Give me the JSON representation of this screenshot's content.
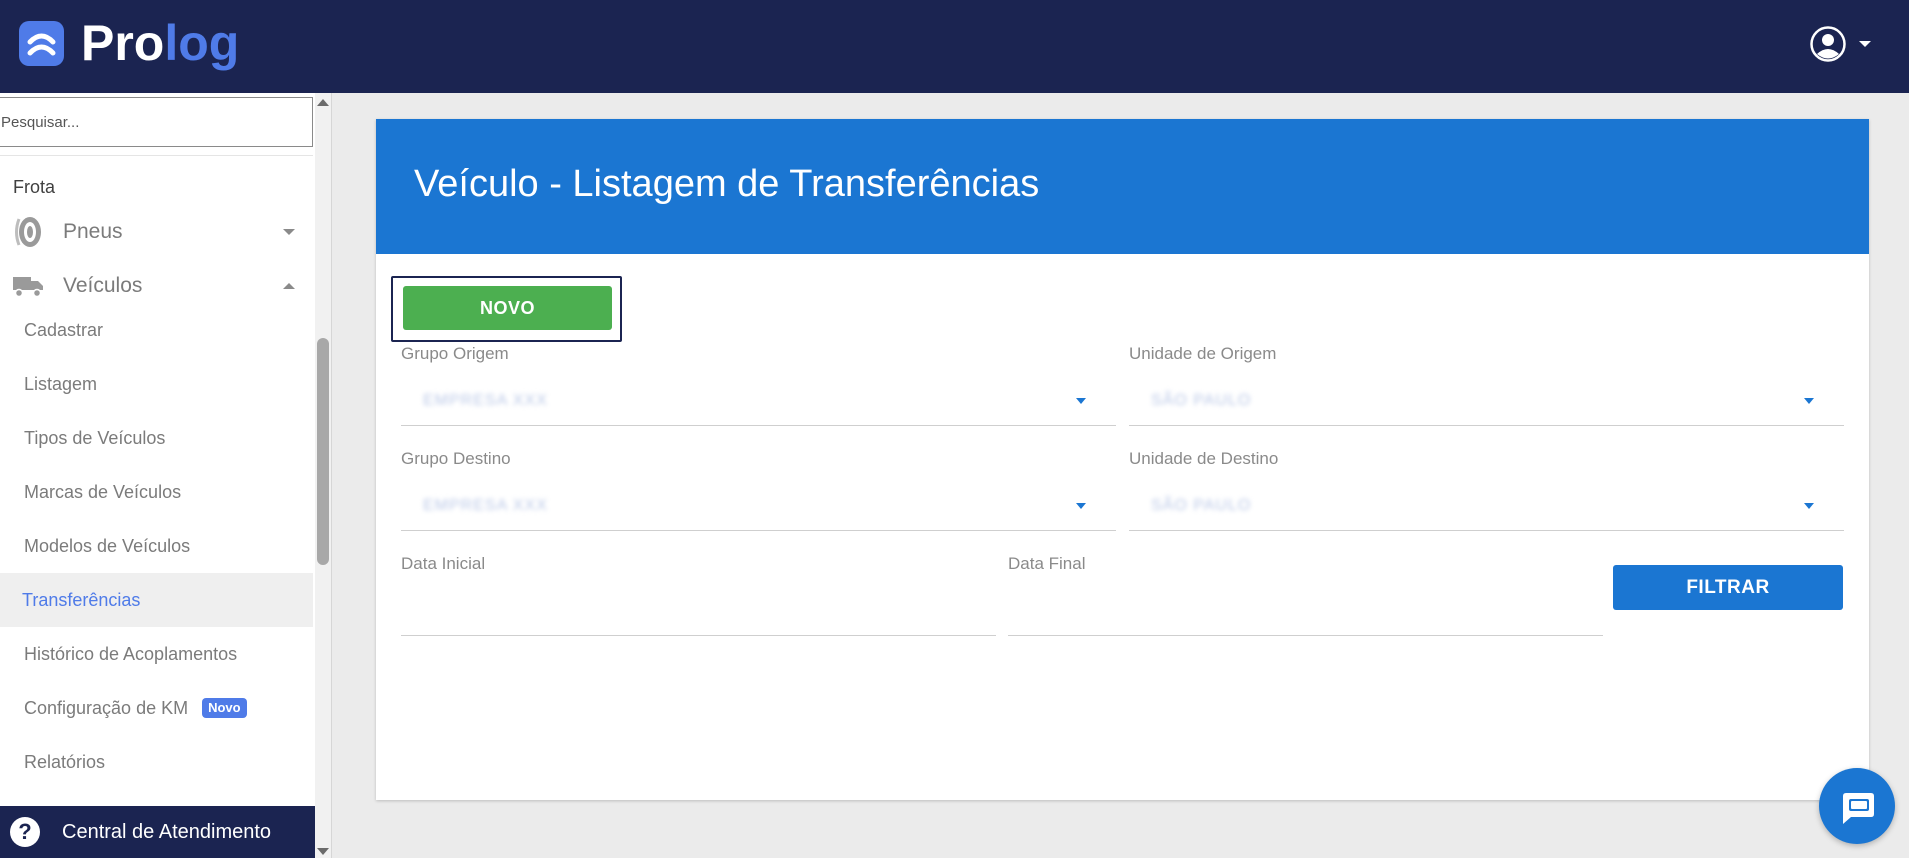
{
  "header": {
    "logo_part1": "Pro",
    "logo_part2": "log",
    "user_icon": "user-circle-icon"
  },
  "sidebar": {
    "search_placeholder": "Pesquisar...",
    "section": "Frota",
    "groups": [
      {
        "label": "Pneus",
        "icon": "tire-icon",
        "expanded": false
      },
      {
        "label": "Veículos",
        "icon": "truck-icon",
        "expanded": true
      }
    ],
    "items": [
      {
        "label": "Cadastrar"
      },
      {
        "label": "Listagem"
      },
      {
        "label": "Tipos de Veículos"
      },
      {
        "label": "Marcas de Veículos"
      },
      {
        "label": "Modelos de Veículos"
      },
      {
        "label": "Transferências",
        "active": true
      },
      {
        "label": "Histórico de Acoplamentos"
      },
      {
        "label": "Configuração de KM",
        "badge": "Novo"
      },
      {
        "label": "Relatórios"
      }
    ],
    "help": {
      "icon": "help-circle-icon",
      "label": "Central de Atendimento"
    }
  },
  "card": {
    "title": "Veículo - Listagem de Transferências",
    "novo_button": "NOVO",
    "fields": {
      "grupo_origem": {
        "label": "Grupo Origem",
        "value": "EMPRESA XXX"
      },
      "unidade_origem": {
        "label": "Unidade de Origem",
        "value": "SÃO PAULO"
      },
      "grupo_destino": {
        "label": "Grupo Destino",
        "value": "EMPRESA XXX"
      },
      "unidade_destino": {
        "label": "Unidade de Destino",
        "value": "SÃO PAULO"
      },
      "data_inicial": {
        "label": "Data Inicial",
        "value": ""
      },
      "data_final": {
        "label": "Data Final",
        "value": ""
      }
    },
    "filtrar_button": "FILTRAR"
  },
  "chat": {
    "icon": "chat-bubble-icon"
  },
  "colors": {
    "header_bg": "#1b2451",
    "brand_accent": "#4f7be8",
    "primary": "#1b76d2",
    "success": "#4caf50"
  }
}
